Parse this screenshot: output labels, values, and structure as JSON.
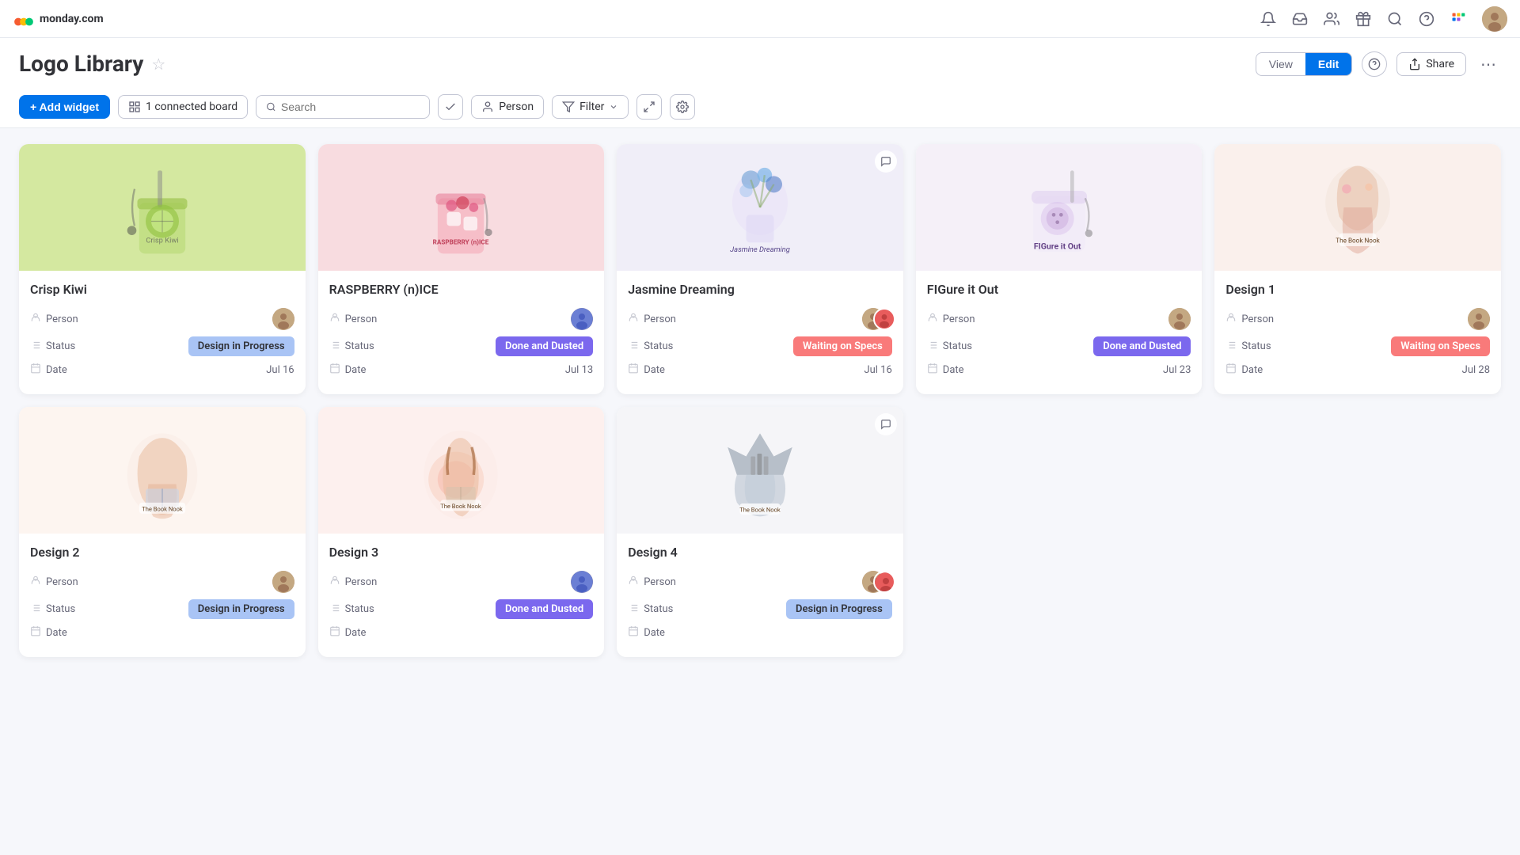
{
  "app": {
    "name": "monday.com"
  },
  "page": {
    "title": "Logo Library",
    "view_label": "View",
    "edit_label": "Edit",
    "active_tab": "Edit"
  },
  "toolbar": {
    "add_widget_label": "+ Add widget",
    "connected_board_label": "1 connected board",
    "search_placeholder": "Search",
    "person_label": "Person",
    "filter_label": "Filter"
  },
  "nav_icons": {
    "bell": "🔔",
    "inbox": "📥",
    "people": "👤",
    "gift": "🎁",
    "search": "🔍",
    "help": "?",
    "more": "⋯"
  },
  "cards": [
    {
      "id": "crisp-kiwi",
      "title": "Crisp Kiwi",
      "person_label": "Person",
      "status_label": "Status",
      "date_label": "Date",
      "status": "Design in Progress",
      "status_class": "status-design-in-progress",
      "date": "Jul 16",
      "image_class": "card-img-crisp-kiwi",
      "has_chat_icon": false
    },
    {
      "id": "raspberry",
      "title": "RASPBERRY (n)ICE",
      "person_label": "Person",
      "status_label": "Status",
      "date_label": "Date",
      "status": "Done and Dusted",
      "status_class": "status-done-dusted",
      "date": "Jul 13",
      "image_class": "card-img-raspberry",
      "has_chat_icon": false
    },
    {
      "id": "jasmine",
      "title": "Jasmine Dreaming",
      "person_label": "Person",
      "status_label": "Status",
      "date_label": "Date",
      "status": "Waiting on Specs",
      "status_class": "status-waiting-specs",
      "date": "Jul 16",
      "image_class": "card-img-jasmine",
      "has_chat_icon": true
    },
    {
      "id": "figure",
      "title": "FIGure it Out",
      "person_label": "Person",
      "status_label": "Status",
      "date_label": "Date",
      "status": "Done and Dusted",
      "status_class": "status-done-dusted",
      "date": "Jul 23",
      "image_class": "card-img-figure",
      "has_chat_icon": false
    },
    {
      "id": "design1",
      "title": "Design 1",
      "person_label": "Person",
      "status_label": "Status",
      "date_label": "Date",
      "status": "Waiting on Specs",
      "status_class": "status-waiting-specs",
      "date": "Jul 28",
      "image_class": "card-img-design1",
      "has_chat_icon": false
    },
    {
      "id": "design2",
      "title": "Design 2",
      "person_label": "Person",
      "status_label": "Status",
      "date_label": "Date",
      "status": "Design in Progress",
      "status_class": "status-design-in-progress",
      "date": "",
      "image_class": "card-img-design2",
      "has_chat_icon": false
    },
    {
      "id": "design3",
      "title": "Design 3",
      "person_label": "Person",
      "status_label": "Status",
      "date_label": "Date",
      "status": "Done and Dusted",
      "status_class": "status-done-dusted",
      "date": "",
      "image_class": "card-img-design3",
      "has_chat_icon": false
    },
    {
      "id": "design4",
      "title": "Design 4",
      "person_label": "Person",
      "status_label": "Status",
      "date_label": "Date",
      "status": "Design in Progress",
      "status_class": "status-design-in-progress",
      "date": "",
      "image_class": "card-img-design4",
      "has_chat_icon": true
    }
  ]
}
